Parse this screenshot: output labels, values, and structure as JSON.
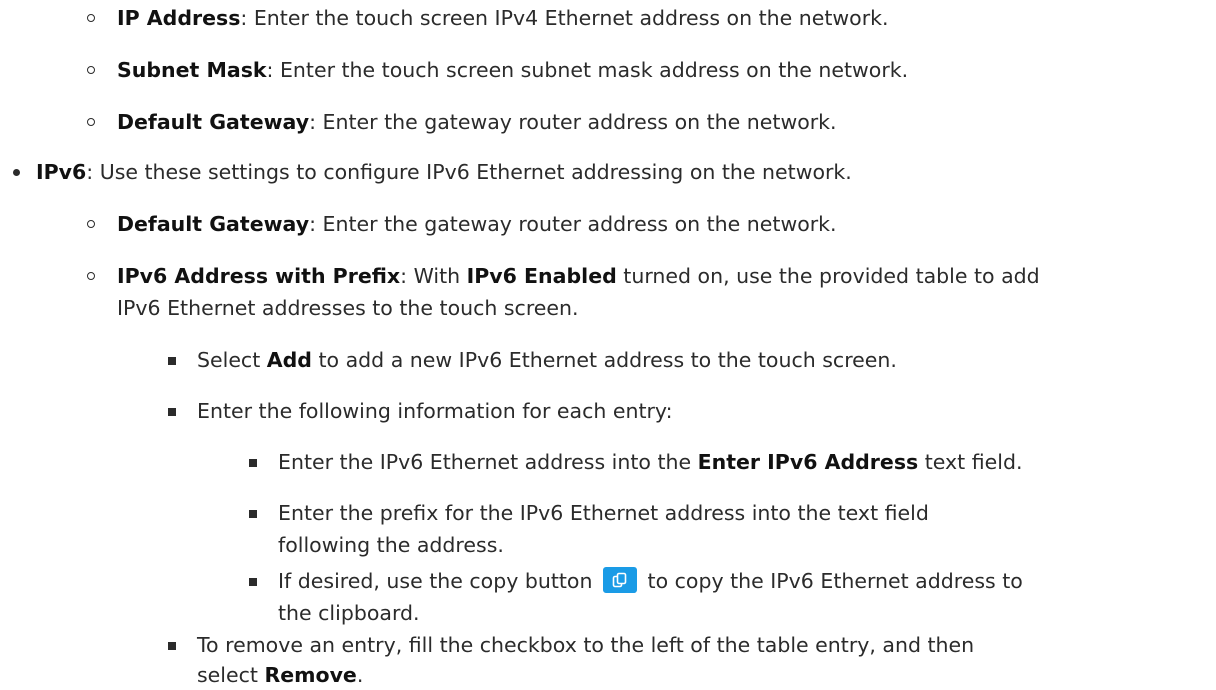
{
  "ipv4": {
    "ip_address": {
      "term": "IP Address",
      "desc": ": Enter the touch screen IPv4 Ethernet address on the network."
    },
    "subnet_mask": {
      "term": "Subnet Mask",
      "desc": ": Enter the touch screen subnet mask address on the network."
    },
    "default_gateway": {
      "term": "Default Gateway",
      "desc": ": Enter the gateway router address on the network."
    }
  },
  "ipv6": {
    "term": "IPv6",
    "desc": ": Use these settings to configure IPv6 Ethernet addressing on the network.",
    "default_gateway": {
      "term": "Default Gateway",
      "desc": ": Enter the gateway router address on the network."
    },
    "address_prefix": {
      "term": "IPv6 Address with Prefix",
      "desc_1": ": With ",
      "enabled_term": "IPv6 Enabled",
      "desc_2": " turned on, use the provided table to add",
      "desc_3": "IPv6 Ethernet addresses to the touch screen."
    },
    "add_step": {
      "pre": "Select ",
      "term": "Add",
      "post": " to add a new IPv6 Ethernet address to the touch screen."
    },
    "enter_info": "Enter the following information for each entry:",
    "enter_address": {
      "pre": "Enter the IPv6 Ethernet address into the ",
      "term": "Enter IPv6 Address",
      "post": " text field."
    },
    "enter_prefix": {
      "line1": "Enter the prefix for the IPv6 Ethernet address into the text field",
      "line2": "following the address."
    },
    "copy_step": {
      "pre": "If desired, use the copy button",
      "post": "to copy the IPv6 Ethernet address to",
      "line2": "the clipboard.",
      "icon": "copy-icon",
      "color": "#1a9be6"
    },
    "remove_step": {
      "line1": "To remove an entry, fill the checkbox to the left of the table entry, and then",
      "pre2": "select ",
      "term": "Remove",
      "post2": "."
    }
  }
}
